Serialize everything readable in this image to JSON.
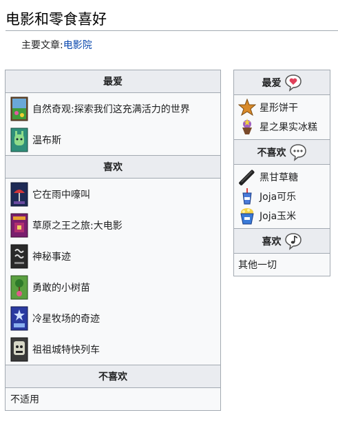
{
  "page": {
    "title": "电影和零食喜好",
    "main_article_label": "主要文章:",
    "main_article_link": "电影院"
  },
  "movies": {
    "loved_header": "最爱",
    "loved": [
      {
        "label": "自然奇观:探索我们这充满活力的世界",
        "icon": "nature-poster-icon"
      },
      {
        "label": "温布斯",
        "icon": "wumbus-poster-icon"
      }
    ],
    "liked_header": "喜欢",
    "liked": [
      {
        "label": "它在雨中嚎叫",
        "icon": "rain-poster-icon"
      },
      {
        "label": "草原之王之旅:大电影",
        "icon": "prairie-king-poster-icon"
      },
      {
        "label": "神秘事迹",
        "icon": "mysterium-poster-icon"
      },
      {
        "label": "勇敢的小树苗",
        "icon": "sapling-poster-icon"
      },
      {
        "label": "冷星牧场的奇迹",
        "icon": "cold-star-poster-icon"
      },
      {
        "label": "祖祖城特快列车",
        "icon": "zuzu-express-poster-icon"
      }
    ],
    "disliked_header": "不喜欢",
    "disliked_value": "不适用"
  },
  "snacks": {
    "loved_header": "最爱",
    "loved": [
      {
        "label": "星形饼干",
        "icon": "star-cookie-icon"
      },
      {
        "label": "星之果实冰糕",
        "icon": "stardrop-sorbet-icon"
      }
    ],
    "disliked_header": "不喜欢",
    "disliked": [
      {
        "label": "黑甘草糖",
        "icon": "black-licorice-icon"
      },
      {
        "label": "Joja可乐",
        "icon": "joja-cola-icon"
      },
      {
        "label": "Joja玉米",
        "icon": "jojacorn-icon"
      }
    ],
    "liked_header": "喜欢",
    "liked_value": "其他一切"
  },
  "colors": {
    "link": "#0645ad",
    "border": "#a2a9b1",
    "header_bg": "#eaecf0",
    "cell_bg": "#f8f9fa"
  }
}
